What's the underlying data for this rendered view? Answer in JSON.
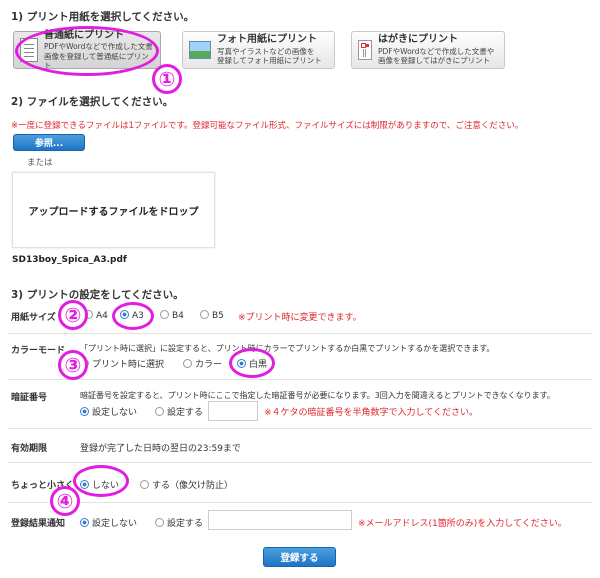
{
  "section1": {
    "title": "1) プリント用紙を選択してください。",
    "buttons": [
      {
        "title": "普通紙にプリント",
        "desc1": "PDFやWordなどで作成した文書",
        "desc2": "画像を登録して普通紙にプリント"
      },
      {
        "title": "フォト用紙にプリント",
        "desc1": "写真やイラストなどの画像を",
        "desc2": "登録してフォト用紙にプリント"
      },
      {
        "title": "はがきにプリント",
        "desc1": "PDFやWordなどで作成した文書や",
        "desc2": "画像を登録してはがきにプリント"
      }
    ]
  },
  "section2": {
    "title": "2) ファイルを選択してください。",
    "notice": "※一度に登録できるファイルは1ファイルです。登録可能なファイル形式、ファイルサイズには制限がありますので、ご注意ください。",
    "browse_label": "参照...",
    "or_label": "または",
    "drop_label": "アップロードするファイルをドロップ",
    "filename": "SD13boy_Spica_A3.pdf"
  },
  "section3": {
    "title": "3) プリントの設定をしてください。",
    "paper_size": {
      "label": "用紙サイズ",
      "options": [
        "A4",
        "A3",
        "B4",
        "B5"
      ],
      "selected": "A3",
      "note": "※プリント時に変更できます。"
    },
    "color_mode": {
      "label": "カラーモード",
      "desc": "「プリント時に選択」に設定すると、プリント時にカラーでプリントするか白黒でプリントするかを選択できます。",
      "options": [
        "プリント時に選択",
        "カラー",
        "白黒"
      ],
      "selected": "白黒"
    },
    "pin": {
      "label": "暗証番号",
      "desc": "暗証番号を設定すると、プリント時にここで指定した暗証番号が必要になります。3回入力を間違えるとプリントできなくなります。",
      "options": [
        "設定しない",
        "設定する"
      ],
      "selected": "設定しない",
      "note": "※４ケタの暗証番号を半角数字で入力してください。"
    },
    "expiry": {
      "label": "有効期限",
      "value": "登録が完了した日時の翌日の23:59まで"
    },
    "shrink": {
      "label": "ちょっと小さく",
      "options": [
        "しない",
        "する（像欠け防止）"
      ],
      "selected": "しない"
    },
    "notify": {
      "label": "登録結果通知",
      "options": [
        "設定しない",
        "設定する"
      ],
      "selected": "設定しない",
      "note": "※メールアドレス(1箇所のみ)を入力してください。"
    }
  },
  "submit_label": "登録する",
  "markers": [
    "①",
    "②",
    "③",
    "④"
  ],
  "colors": {
    "accent": "#1f74c4",
    "warning": "#e0262a",
    "highlight": "#e11ee0"
  }
}
